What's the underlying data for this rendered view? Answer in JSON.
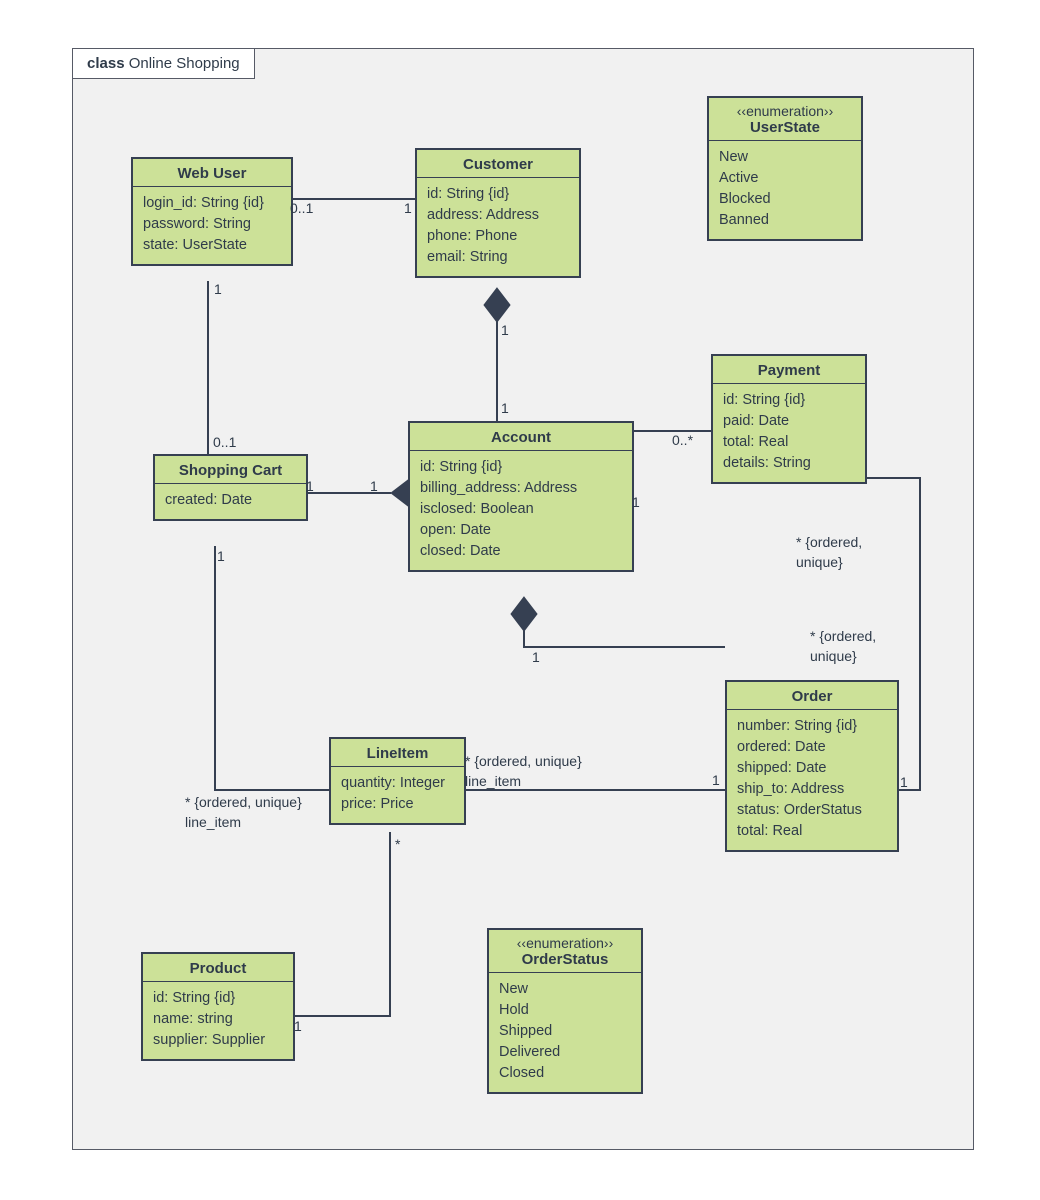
{
  "diagram": {
    "frame_kind": "class",
    "frame_name": "Online Shopping",
    "classes": {
      "webuser": {
        "name": "Web User",
        "attrs": [
          "login_id: String {id}",
          "password: String",
          "state: UserState"
        ]
      },
      "customer": {
        "name": "Customer",
        "attrs": [
          "id: String {id}",
          "address: Address",
          "phone: Phone",
          "email: String"
        ]
      },
      "userstate": {
        "stereotype": "‹‹enumeration››",
        "name": "UserState",
        "attrs": [
          "New",
          "Active",
          "Blocked",
          "Banned"
        ]
      },
      "shoppingcart": {
        "name": "Shopping Cart",
        "attrs": [
          "created: Date"
        ]
      },
      "account": {
        "name": "Account",
        "attrs": [
          "id: String {id}",
          "billing_address: Address",
          "isclosed: Boolean",
          "open: Date",
          "closed: Date"
        ]
      },
      "payment": {
        "name": "Payment",
        "attrs": [
          "id: String {id}",
          "paid: Date",
          "total: Real",
          "details: String"
        ]
      },
      "lineitem": {
        "name": "LineItem",
        "attrs": [
          "quantity: Integer",
          "price: Price"
        ]
      },
      "order": {
        "name": "Order",
        "attrs": [
          "number: String {id}",
          "ordered: Date",
          "shipped: Date",
          "ship_to: Address",
          "status: OrderStatus",
          "total: Real"
        ]
      },
      "product": {
        "name": "Product",
        "attrs": [
          "id: String {id}",
          "name: string",
          "supplier: Supplier"
        ]
      },
      "orderstatus": {
        "stereotype": "‹‹enumeration››",
        "name": "OrderStatus",
        "attrs": [
          "New",
          "Hold",
          "Shipped",
          "Delivered",
          "Closed"
        ]
      }
    },
    "labels": {
      "m01a": "0..1",
      "m01b": "0..1",
      "m0s": "0..*",
      "m1": "1",
      "star": "*",
      "ordered_unique": "* {ordered, unique}",
      "ordered_unique_two": "* {ordered,",
      "ordered_unique_close": "unique}",
      "line_item": "line_item"
    }
  }
}
